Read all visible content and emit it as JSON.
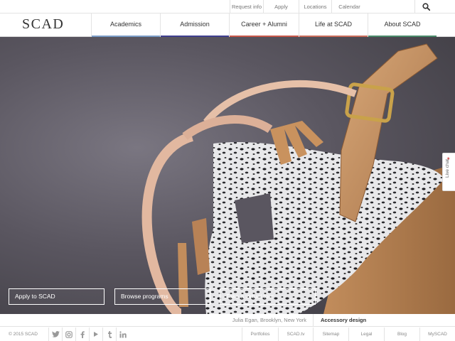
{
  "utility": {
    "links": [
      "Request info",
      "Apply",
      "Locations",
      "Calendar"
    ],
    "search_icon": "search-icon"
  },
  "brand": {
    "logo": "SCAD"
  },
  "nav": {
    "items": [
      {
        "label": "Academics",
        "accent": "#7a9cc6"
      },
      {
        "label": "Admission",
        "accent": "#3f3f8f"
      },
      {
        "label": "Career + Alumni",
        "accent": "#c8584a"
      },
      {
        "label": "Life at SCAD",
        "accent": "#c96c5a"
      },
      {
        "label": "About SCAD",
        "accent": "#4a8a6a"
      }
    ]
  },
  "hero": {
    "ctas": [
      "Apply to SCAD",
      "Browse programs",
      "Take a virtual tour"
    ],
    "live_chat": "Live chat"
  },
  "caption": {
    "credit": "Julia Egan, Brooklyn, New York",
    "category": "Accessory design"
  },
  "footer": {
    "copyright": "© 2015 SCAD",
    "social": [
      "twitter-icon",
      "instagram-icon",
      "facebook-icon",
      "youtube-icon",
      "tumblr-icon",
      "linkedin-icon"
    ],
    "links": [
      "Portfolios",
      "SCAD.tv",
      "Sitemap",
      "Legal",
      "Blog",
      "MySCAD"
    ]
  }
}
